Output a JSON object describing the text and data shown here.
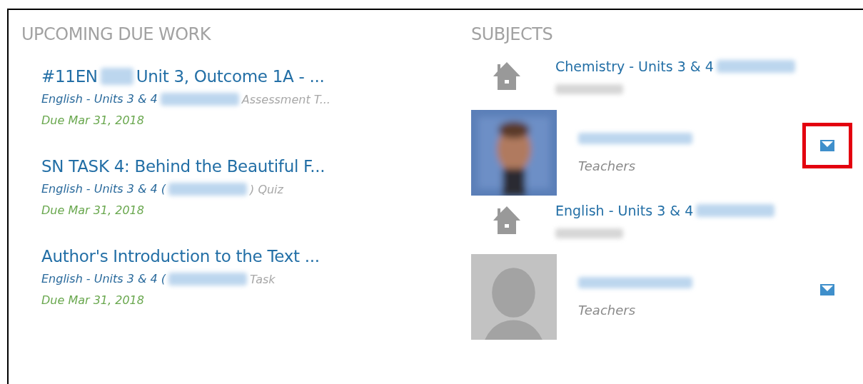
{
  "due_work": {
    "heading": "UPCOMING DUE WORK",
    "items": [
      {
        "title_start": "#11EN",
        "title_end": "Unit 3, Outcome 1A - ...",
        "subject": "English - Units 3 & 4",
        "type": "Assessment T...",
        "due": "Due Mar 31, 2018"
      },
      {
        "title_start": "SN TASK 4: Behind the Beautiful F...",
        "subject": "English - Units 3 & 4 (",
        "type": ") Quiz",
        "due": "Due Mar 31, 2018"
      },
      {
        "title_start": "Author's Introduction to the Text ...",
        "subject": "English - Units 3 & 4 (",
        "type": "Task",
        "due": "Due Mar 31, 2018"
      }
    ]
  },
  "subjects": {
    "heading": "SUBJECTS",
    "items": [
      {
        "name": "Chemistry - Units 3 & 4",
        "teacher": {
          "role": "Teachers",
          "highlighted": true
        }
      },
      {
        "name": "English - Units 3 & 4",
        "teacher": {
          "kind": "placeholder",
          "role": "Teachers",
          "highlighted": false
        }
      }
    ]
  }
}
